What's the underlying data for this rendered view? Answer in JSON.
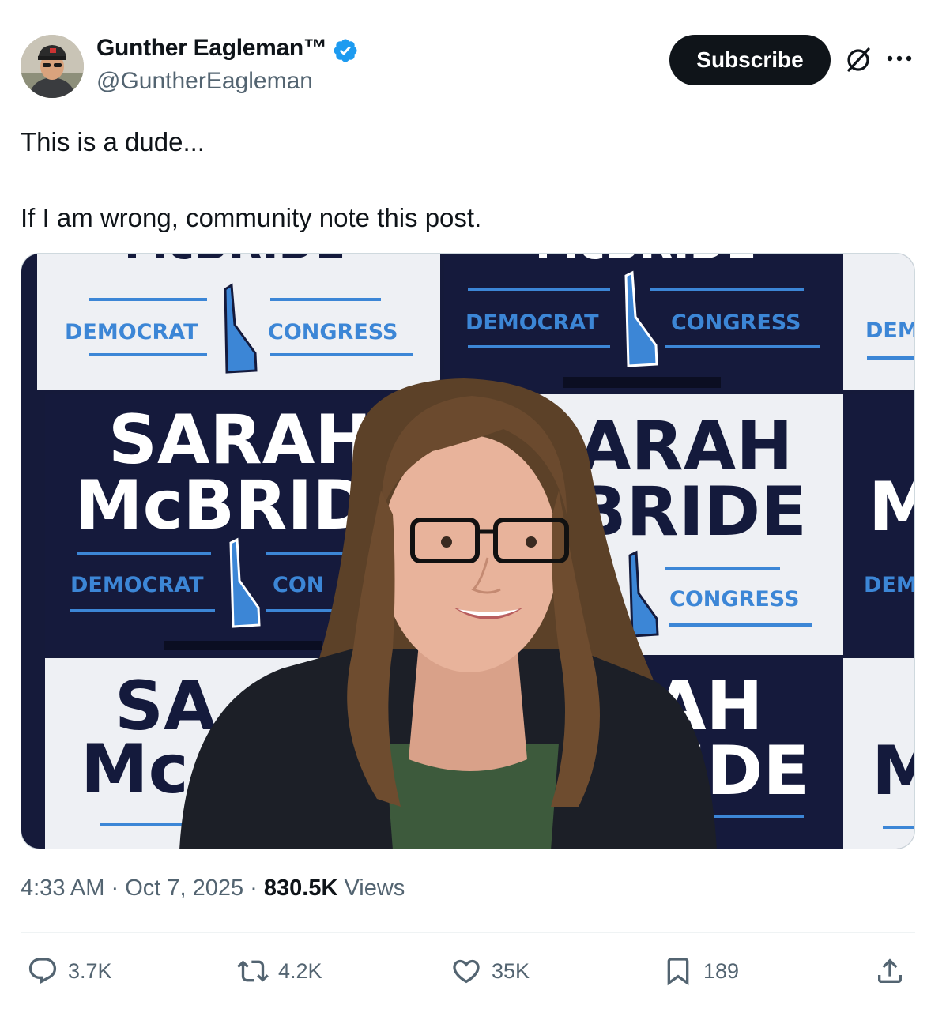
{
  "author": {
    "name": "Gunther Eagleman™",
    "handle": "@GuntherEagleman"
  },
  "header": {
    "subscribe_label": "Subscribe"
  },
  "icons": {
    "verified": "verified-badge-icon",
    "grok": "grok-icon",
    "more": "more-icon",
    "reply": "reply-icon",
    "repost": "repost-icon",
    "like": "heart-icon",
    "bookmark": "bookmark-icon",
    "share": "share-icon"
  },
  "colors": {
    "verified_blue": "#1d9bf0",
    "text_primary": "#0f1419",
    "text_secondary": "#536471",
    "sign_navy": "#141a3c",
    "sign_blue": "#3c86d6"
  },
  "post": {
    "lines": [
      "This is a dude...",
      "If I am wrong,  community note this post."
    ]
  },
  "media": {
    "sign_texts": {
      "first_name": "SARAH",
      "last_name": "McBRIDE",
      "party": "DEMOCRAT",
      "office": "CONGRESS",
      "first_fragment_1": "ARAH",
      "last_fragment_1": "BRIDE",
      "party_fragment": "DEM",
      "office_fragment": "CON",
      "first_fragment_2": "SA",
      "last_fragment_2": "Mc",
      "first_fragment_3": "AH",
      "last_fragment_3": "IDE",
      "initial": "M"
    }
  },
  "meta": {
    "time": "4:33 AM",
    "separator": " · ",
    "date": "Oct 7, 2025",
    "views_count": "830.5K",
    "views_label": " Views"
  },
  "actions": {
    "replies": "3.7K",
    "reposts": "4.2K",
    "likes": "35K",
    "bookmarks": "189"
  }
}
